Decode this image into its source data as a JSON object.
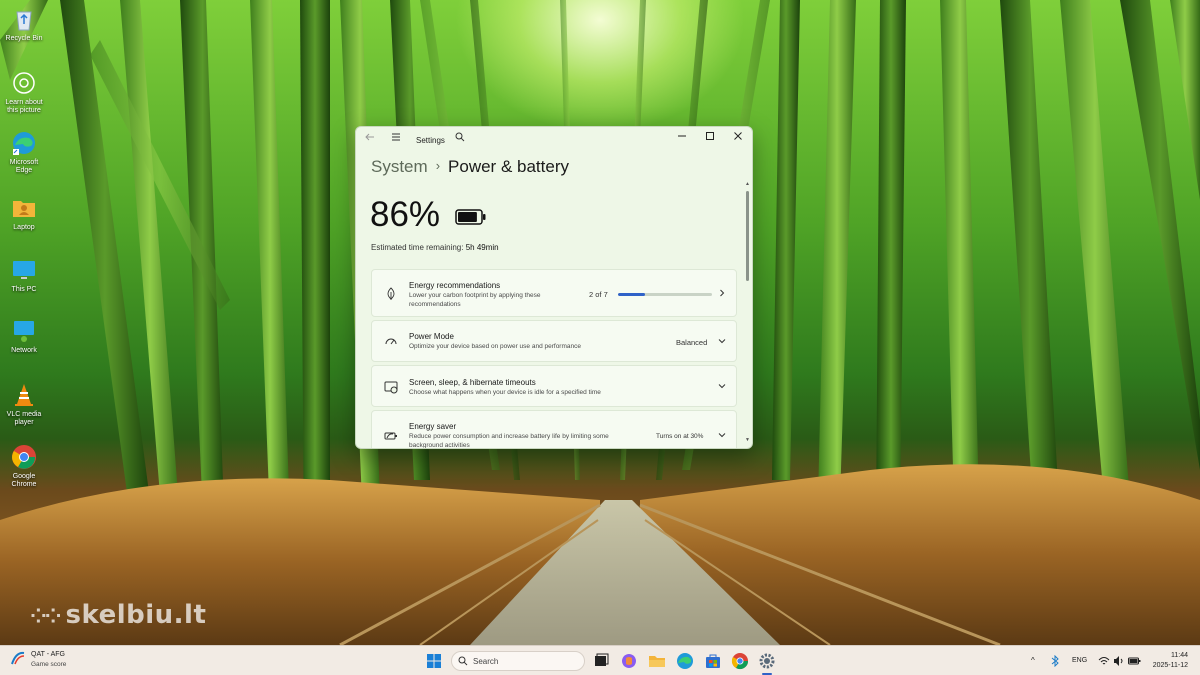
{
  "desktop": {
    "icons": [
      {
        "label": "Recycle Bin",
        "icon": "recycle-bin-icon"
      },
      {
        "label": "Learn about this picture",
        "icon": "camera-icon"
      },
      {
        "label": "Microsoft Edge",
        "icon": "edge-icon"
      },
      {
        "label": "Laptop",
        "icon": "user-folder-icon"
      },
      {
        "label": "This PC",
        "icon": "monitor-icon"
      },
      {
        "label": "Network",
        "icon": "network-icon"
      },
      {
        "label": "VLC media player",
        "icon": "vlc-cone-icon"
      },
      {
        "label": "Google Chrome",
        "icon": "chrome-icon"
      }
    ],
    "watermark": "skelbiu.lt"
  },
  "settings": {
    "app_title": "Settings",
    "breadcrumb_parent": "System",
    "breadcrumb_separator": "›",
    "page_title": "Power & battery",
    "battery_percent": "86%",
    "battery_level": 0.86,
    "estimated_label": "Estimated time remaining:",
    "estimated_value": "5h 49min",
    "cards": {
      "energy": {
        "title": "Energy recommendations",
        "desc": "Lower your carbon footprint by applying these recommendations",
        "count": "2 of 7",
        "progress": 0.286
      },
      "power_mode": {
        "title": "Power Mode",
        "desc": "Optimize your device based on power use and performance",
        "value": "Balanced"
      },
      "timeouts": {
        "title": "Screen, sleep, & hibernate timeouts",
        "desc": "Choose what happens when your device is idle for a specified time"
      },
      "saver": {
        "title": "Energy saver",
        "desc": "Reduce power consumption and increase battery life by limiting some background activities",
        "value": "Turns on at 30%"
      }
    }
  },
  "taskbar": {
    "widget_title": "QAT - AFG",
    "widget_sub": "Game score",
    "search_placeholder": "Search",
    "lang": "ENG",
    "time": "11:44",
    "date": "2025-11-12",
    "accent": "#2f62c8"
  }
}
